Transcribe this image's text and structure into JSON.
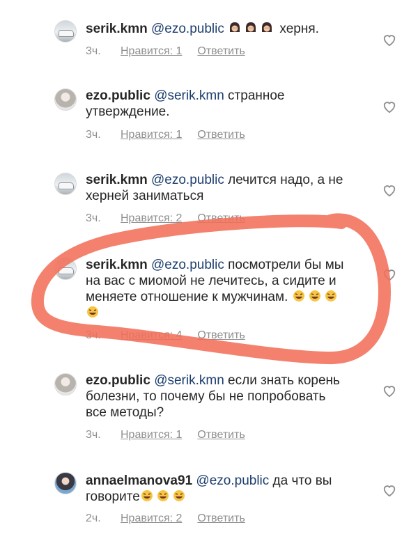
{
  "comments": [
    {
      "username": "serik.kmn",
      "mention": "@ezo.public",
      "text_after": "херня.",
      "emoji_before": 3,
      "time": "3ч.",
      "likes": "Нравится: 1",
      "reply": "Ответить"
    },
    {
      "username": "ezo.public",
      "mention": "@serik.kmn",
      "text": "странное утверждение.",
      "time": "3ч.",
      "likes": "Нравится: 1",
      "reply": "Ответить"
    },
    {
      "username": "serik.kmn",
      "mention": "@ezo.public",
      "text": "лечится надо, а не херней заниматься",
      "time": "3ч.",
      "likes": "Нравится: 2",
      "reply": "Ответить"
    },
    {
      "username": "serik.kmn",
      "mention": "@ezo.public",
      "text": "посмотрели бы мы на вас с миомой не лечитесь, а сидите и меняете отношение к мужчинам.",
      "emoji_after": 4,
      "time": "3ч.",
      "likes": "Нравится: 4",
      "reply": "Ответить"
    },
    {
      "username": "ezo.public",
      "mention": "@serik.kmn",
      "text": "если знать корень болезни, то почему бы не попробовать все методы?",
      "time": "3ч.",
      "likes": "Нравится: 1",
      "reply": "Ответить"
    },
    {
      "username": "annaelmanova91",
      "mention": "@ezo.public",
      "text": "да что вы говорите",
      "emoji_after": 3,
      "time": "2ч.",
      "likes": "Нравится: 2",
      "reply": "Ответить"
    }
  ],
  "colors": {
    "mention": "#1b3d6e",
    "meta": "#8e8e8e",
    "annotation": "#f26f5a"
  },
  "icons": {
    "like": "heart-outline-icon",
    "emoji_1": "facepalm-woman-emoji",
    "emoji_2": "rofl-emoji"
  }
}
